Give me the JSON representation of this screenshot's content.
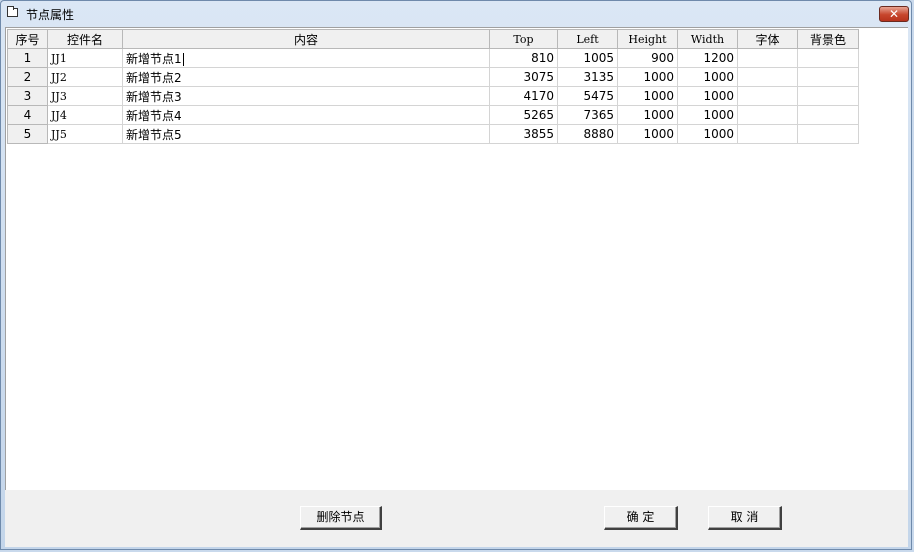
{
  "window": {
    "title": "节点属性",
    "close_label": "✕"
  },
  "grid": {
    "columns": [
      "序号",
      "控件名",
      "内容",
      "Top",
      "Left",
      "Height",
      "Width",
      "字体",
      "背景色"
    ],
    "rows": [
      {
        "no": "1",
        "name": "JJ1",
        "content": "新增节点1",
        "top": "810",
        "left": "1005",
        "height": "900",
        "width": "1200",
        "font": "",
        "bg": ""
      },
      {
        "no": "2",
        "name": "JJ2",
        "content": "新增节点2",
        "top": "3075",
        "left": "3135",
        "height": "1000",
        "width": "1000",
        "font": "",
        "bg": ""
      },
      {
        "no": "3",
        "name": "JJ3",
        "content": "新增节点3",
        "top": "4170",
        "left": "5475",
        "height": "1000",
        "width": "1000",
        "font": "",
        "bg": ""
      },
      {
        "no": "4",
        "name": "JJ4",
        "content": "新增节点4",
        "top": "5265",
        "left": "7365",
        "height": "1000",
        "width": "1000",
        "font": "",
        "bg": ""
      },
      {
        "no": "5",
        "name": "JJ5",
        "content": "新增节点5",
        "top": "3855",
        "left": "8880",
        "height": "1000",
        "width": "1000",
        "font": "",
        "bg": ""
      }
    ]
  },
  "buttons": {
    "delete_label": "删除节点",
    "ok_label": "确 定",
    "cancel_label": "取 消"
  }
}
